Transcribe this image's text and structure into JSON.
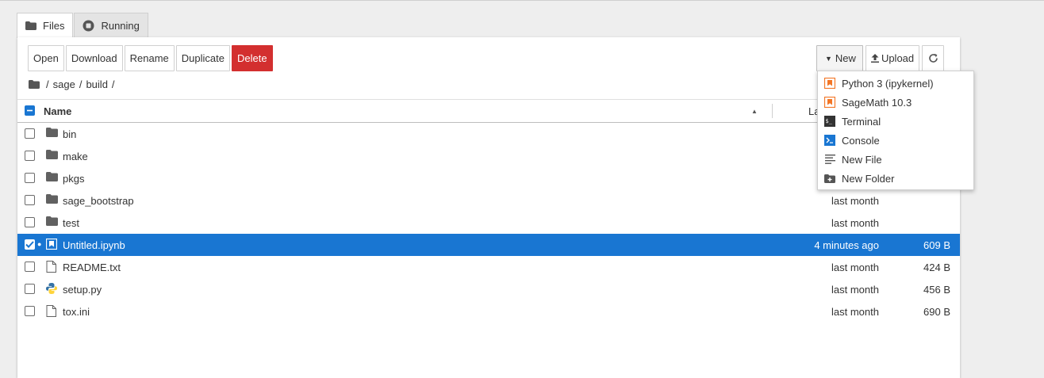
{
  "tabs": [
    {
      "label": "Files",
      "icon": "folder-icon"
    },
    {
      "label": "Running",
      "icon": "stop-circle-icon"
    }
  ],
  "toolbar": {
    "open": "Open",
    "download": "Download",
    "rename": "Rename",
    "duplicate": "Duplicate",
    "delete": "Delete",
    "new": "New",
    "upload": "Upload"
  },
  "breadcrumb": [
    "/",
    "sage",
    "/",
    "build",
    "/"
  ],
  "header": {
    "name": "Name",
    "modified": "La"
  },
  "files": [
    {
      "name": "bin",
      "type": "folder",
      "modified": "",
      "size": ""
    },
    {
      "name": "make",
      "type": "folder",
      "modified": "",
      "size": ""
    },
    {
      "name": "pkgs",
      "type": "folder",
      "modified": "",
      "size": ""
    },
    {
      "name": "sage_bootstrap",
      "type": "folder",
      "modified": "last month",
      "size": ""
    },
    {
      "name": "test",
      "type": "folder",
      "modified": "last month",
      "size": ""
    },
    {
      "name": "Untitled.ipynb",
      "type": "notebook",
      "modified": "4 minutes ago",
      "size": "609 B",
      "selected": true
    },
    {
      "name": "README.txt",
      "type": "file",
      "modified": "last month",
      "size": "424 B"
    },
    {
      "name": "setup.py",
      "type": "python",
      "modified": "last month",
      "size": "456 B"
    },
    {
      "name": "tox.ini",
      "type": "file",
      "modified": "last month",
      "size": "690 B"
    }
  ],
  "new_menu": [
    {
      "label": "Python 3 (ipykernel)",
      "icon": "notebook-icon"
    },
    {
      "label": "SageMath 10.3",
      "icon": "notebook-icon"
    },
    {
      "label": "Terminal",
      "icon": "terminal-icon"
    },
    {
      "label": "Console",
      "icon": "console-icon"
    },
    {
      "label": "New File",
      "icon": "text-file-icon"
    },
    {
      "label": "New Folder",
      "icon": "new-folder-icon"
    }
  ],
  "colors": {
    "accent": "#1976d2",
    "danger": "#d32f2f",
    "notebook": "#f37626"
  }
}
